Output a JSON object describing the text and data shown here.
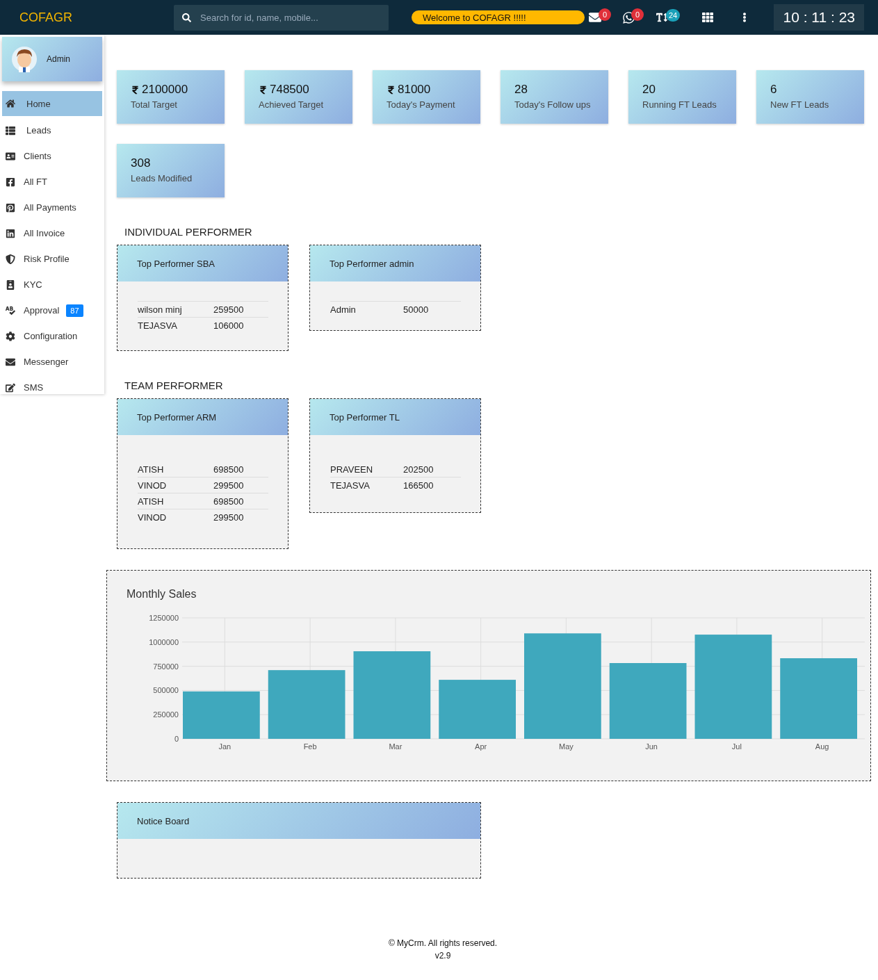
{
  "topbar": {
    "logo": "COFAGR",
    "search": {
      "placeholder": "Search for id, name, mobile..."
    },
    "welcome": "Welcome to COFAGR !!!!!",
    "mail_count": "0",
    "whatsapp_count": "0",
    "text_count": "24",
    "clock": "10 : 11 : 23"
  },
  "user": {
    "name": "Admin"
  },
  "sidebar": {
    "items": [
      {
        "label": "Home",
        "selected": true
      },
      {
        "label": "Leads",
        "selected": false
      },
      {
        "label": "Clients",
        "selected": false
      },
      {
        "label": "All FT",
        "selected": false
      },
      {
        "label": "All Payments",
        "selected": false
      },
      {
        "label": "All Invoice",
        "selected": false
      },
      {
        "label": "Risk Profile",
        "selected": false
      },
      {
        "label": "KYC",
        "selected": false
      },
      {
        "label": "Approval",
        "selected": false,
        "badge": "87"
      },
      {
        "label": "Configuration",
        "selected": false
      },
      {
        "label": "Messenger",
        "selected": false
      },
      {
        "label": "SMS",
        "selected": false
      }
    ]
  },
  "stats": [
    {
      "value": "2100000",
      "label": "Total Target",
      "currency": true
    },
    {
      "value": "748500",
      "label": "Achieved Target",
      "currency": true
    },
    {
      "value": "81000",
      "label": "Today's Payment",
      "currency": true
    },
    {
      "value": "28",
      "label": "Today's Follow ups",
      "currency": false
    },
    {
      "value": "20",
      "label": "Running FT Leads",
      "currency": false
    },
    {
      "value": "6",
      "label": "New FT Leads",
      "currency": false
    },
    {
      "value": "308",
      "label": "Leads Modified",
      "currency": false
    }
  ],
  "sections": [
    {
      "title": "INDIVIDUAL PERFORMER",
      "cards": [
        {
          "title": "Top Performer SBA",
          "rows": [
            {
              "name": "wilson minj",
              "amount": "259500"
            },
            {
              "name": "TEJASVA",
              "amount": "106000"
            }
          ]
        },
        {
          "title": "Top Performer admin",
          "rows": [
            {
              "name": "Admin",
              "amount": "50000"
            }
          ]
        }
      ]
    },
    {
      "title": "TEAM PERFORMER",
      "cards": [
        {
          "title": "Top Performer ARM",
          "rows": [
            {
              "name": "ATISH",
              "amount": "698500"
            },
            {
              "name": "VINOD",
              "amount": "299500"
            },
            {
              "name": "ATISH",
              "amount": "698500"
            },
            {
              "name": "VINOD",
              "amount": "299500"
            }
          ]
        },
        {
          "title": "Top Performer TL",
          "rows": [
            {
              "name": "PRAVEEN",
              "amount": "202500"
            },
            {
              "name": "TEJASVA",
              "amount": "166500"
            }
          ]
        }
      ]
    }
  ],
  "sales": {
    "title": "Monthly Sales",
    "chart_data": {
      "type": "bar",
      "categories": [
        "Jan",
        "Feb",
        "Mar",
        "Apr",
        "May",
        "Jun",
        "Jul",
        "Aug"
      ],
      "grid": true,
      "series": [
        {
          "color": "#3fa8bd",
          "values": [
            490000,
            710000,
            905000,
            610000,
            1090000,
            783000,
            1077000,
            833000
          ]
        }
      ],
      "ylim": [
        0,
        1250000
      ],
      "yticks": [
        0,
        250000,
        500000,
        750000,
        1000000,
        1250000
      ]
    }
  },
  "notice_board": {
    "title": "Notice Board"
  },
  "footer": {
    "copyright": "© MyCrm. All rights reserved.",
    "version": "v2.9"
  }
}
